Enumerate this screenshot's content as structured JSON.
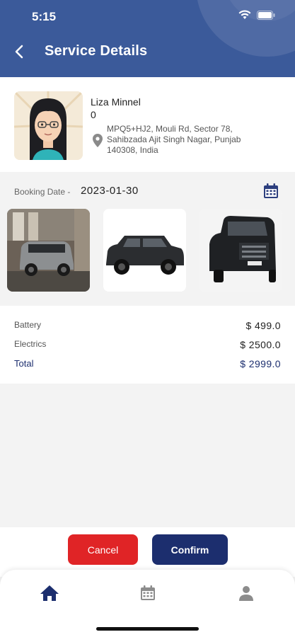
{
  "status_bar": {
    "time": "5:15"
  },
  "header": {
    "title": "Service Details"
  },
  "profile": {
    "name": "Liza Minnel",
    "secondary": "0",
    "address": "MPQ5+HJ2, Mouli Rd, Sector 78, Sahibzada Ajit Singh Nagar, Punjab 140308, India"
  },
  "booking": {
    "label": "Booking Date -",
    "date": "2023-01-30"
  },
  "vehicle_images": [
    "silver SUV photo",
    "black SUV photo",
    "black SUV front photo"
  ],
  "services": {
    "items": [
      {
        "name": "Battery",
        "price": "$ 499.0"
      },
      {
        "name": "Electrics",
        "price": "$ 2500.0"
      }
    ],
    "total_label": "Total",
    "total_value": "$ 2999.0"
  },
  "actions": {
    "cancel": "Cancel",
    "confirm": "Confirm"
  },
  "tabs": [
    "home-icon",
    "calendar-icon",
    "person-icon"
  ],
  "colors": {
    "header": "#3b5a9a",
    "primary": "#1c2e6e",
    "danger": "#e02426"
  }
}
